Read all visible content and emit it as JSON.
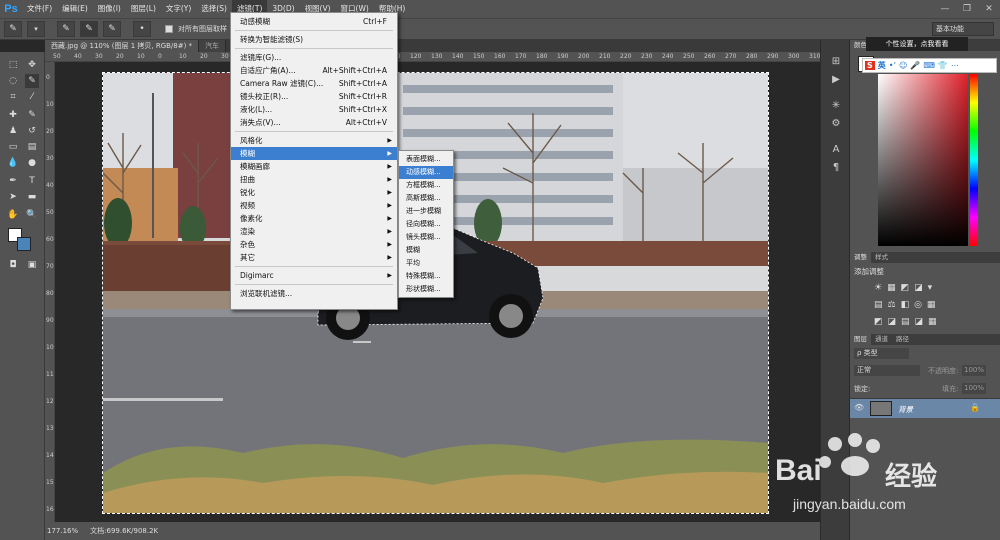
{
  "app": {
    "logo": "Ps"
  },
  "menubar": [
    "文件(F)",
    "编辑(E)",
    "图像(I)",
    "图层(L)",
    "文字(Y)",
    "选择(S)",
    "滤镜(T)",
    "3D(D)",
    "视图(V)",
    "窗口(W)",
    "帮助(H)"
  ],
  "options": {
    "sample_all": "对所有图层取样",
    "auto": "自"
  },
  "workspace": "基本功能",
  "tabs": [
    "西藏.jpg @ 110% (图层 1 拷贝, RGB/8#) *",
    "汽车"
  ],
  "ruler_top": [
    "50",
    "40",
    "30",
    "20",
    "10",
    "0",
    "10",
    "20",
    "30",
    "40",
    "50",
    "60",
    "70",
    "80",
    "90",
    "100",
    "110",
    "120",
    "130",
    "140",
    "150",
    "160",
    "170",
    "180",
    "190",
    "200",
    "210",
    "220",
    "230",
    "240",
    "250",
    "260",
    "270",
    "280",
    "290",
    "300",
    "310"
  ],
  "ruler_left": [
    "0",
    "10",
    "20",
    "30",
    "40",
    "50",
    "60",
    "70",
    "80",
    "90",
    "100",
    "110",
    "120",
    "130",
    "140",
    "150",
    "160"
  ],
  "status": {
    "zoom": "177.16%",
    "doc": "文档:699.6K/908.2K"
  },
  "filter_menu": {
    "items": [
      {
        "label": "动感模糊",
        "shortcut": "Ctrl+F"
      },
      {
        "sep": true
      },
      {
        "label": "转换为智能滤镜(S)"
      },
      {
        "sep": true
      },
      {
        "label": "滤镜库(G)..."
      },
      {
        "label": "自适应广角(A)...",
        "shortcut": "Alt+Shift+Ctrl+A"
      },
      {
        "label": "Camera Raw 滤镜(C)...",
        "shortcut": "Shift+Ctrl+A"
      },
      {
        "label": "镜头校正(R)...",
        "shortcut": "Shift+Ctrl+R"
      },
      {
        "label": "液化(L)...",
        "shortcut": "Shift+Ctrl+X"
      },
      {
        "label": "消失点(V)...",
        "shortcut": "Alt+Ctrl+V"
      },
      {
        "sep": true
      },
      {
        "label": "风格化",
        "sub": true
      },
      {
        "label": "模糊",
        "sub": true,
        "highlight": true
      },
      {
        "label": "模糊画廊",
        "sub": true
      },
      {
        "label": "扭曲",
        "sub": true
      },
      {
        "label": "锐化",
        "sub": true
      },
      {
        "label": "视频",
        "sub": true
      },
      {
        "label": "像素化",
        "sub": true
      },
      {
        "label": "渲染",
        "sub": true
      },
      {
        "label": "杂色",
        "sub": true
      },
      {
        "label": "其它",
        "sub": true
      },
      {
        "sep": true
      },
      {
        "label": "Digimarc",
        "sub": true
      },
      {
        "sep": true
      },
      {
        "label": "浏览联机滤镜..."
      }
    ]
  },
  "blur_submenu": [
    "表面模糊...",
    "动感模糊...",
    "方框模糊...",
    "高斯模糊...",
    "进一步模糊",
    "径向模糊...",
    "镜头模糊...",
    "模糊",
    "平均",
    "特殊模糊...",
    "形状模糊..."
  ],
  "blur_submenu_highlight": 1,
  "ime": {
    "tip": "个性设置，点我看看",
    "brand": "S",
    "lang": "英"
  },
  "panels": {
    "color_tab": "颜色",
    "adjust_tabs": [
      "调整",
      "样式"
    ],
    "adjust_title": "添加调整",
    "layers_tabs": [
      "图层",
      "通道",
      "路径"
    ],
    "kind": "类型",
    "blend": "正常",
    "opacity_label": "不透明度:",
    "opacity": "100%",
    "lock_label": "锁定:",
    "fill_label": "填充:",
    "fill": "100%",
    "layer_name": "背景"
  },
  "watermark": {
    "brand": "Bai",
    "brand2": "经验",
    "url": "jingyan.baidu.com"
  }
}
